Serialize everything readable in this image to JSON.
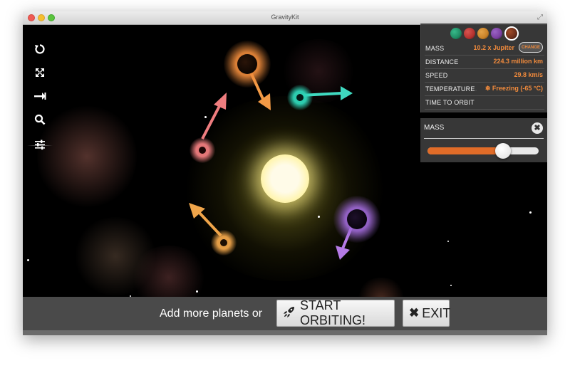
{
  "window": {
    "title": "GravityKit"
  },
  "toolbar": {
    "tools": [
      {
        "name": "reset-icon"
      },
      {
        "name": "fullscreen-icon"
      },
      {
        "name": "arrow-right-icon"
      },
      {
        "name": "search-icon"
      },
      {
        "name": "settings-sliders-icon"
      }
    ]
  },
  "planet_swatches": [
    "#1f8a63",
    "#b5322e",
    "#c98228",
    "#7a3fa0",
    "#6b2e1a"
  ],
  "info": {
    "mass_label": "MASS",
    "mass_value": "10.2 x Jupiter",
    "change_label": "CHANGE",
    "distance_label": "DISTANCE",
    "distance_value": "224.3 million km",
    "speed_label": "SPEED",
    "speed_value": "29.8 km/s",
    "temperature_label": "TEMPERATURE",
    "temperature_value": "❄ Freezing (-65 °C)",
    "time_label": "TIME TO ORBIT",
    "time_value": ""
  },
  "mass_panel": {
    "title": "MASS",
    "close_glyph": "✖",
    "slider_fraction": 0.68
  },
  "bottom": {
    "prompt": "Add more planets or",
    "start_label": "START ORBITING!",
    "exit_label": "EXIT"
  },
  "colors": {
    "accent": "#f08a3c",
    "slider_fill": "#e16c28",
    "sun": "#fffbd0",
    "planet_orange": "#e9843a",
    "planet_teal": "#2fd6b8",
    "planet_pink": "#ef7d7f",
    "planet_gold": "#f0a54a",
    "planet_purple": "#a06ad8"
  }
}
